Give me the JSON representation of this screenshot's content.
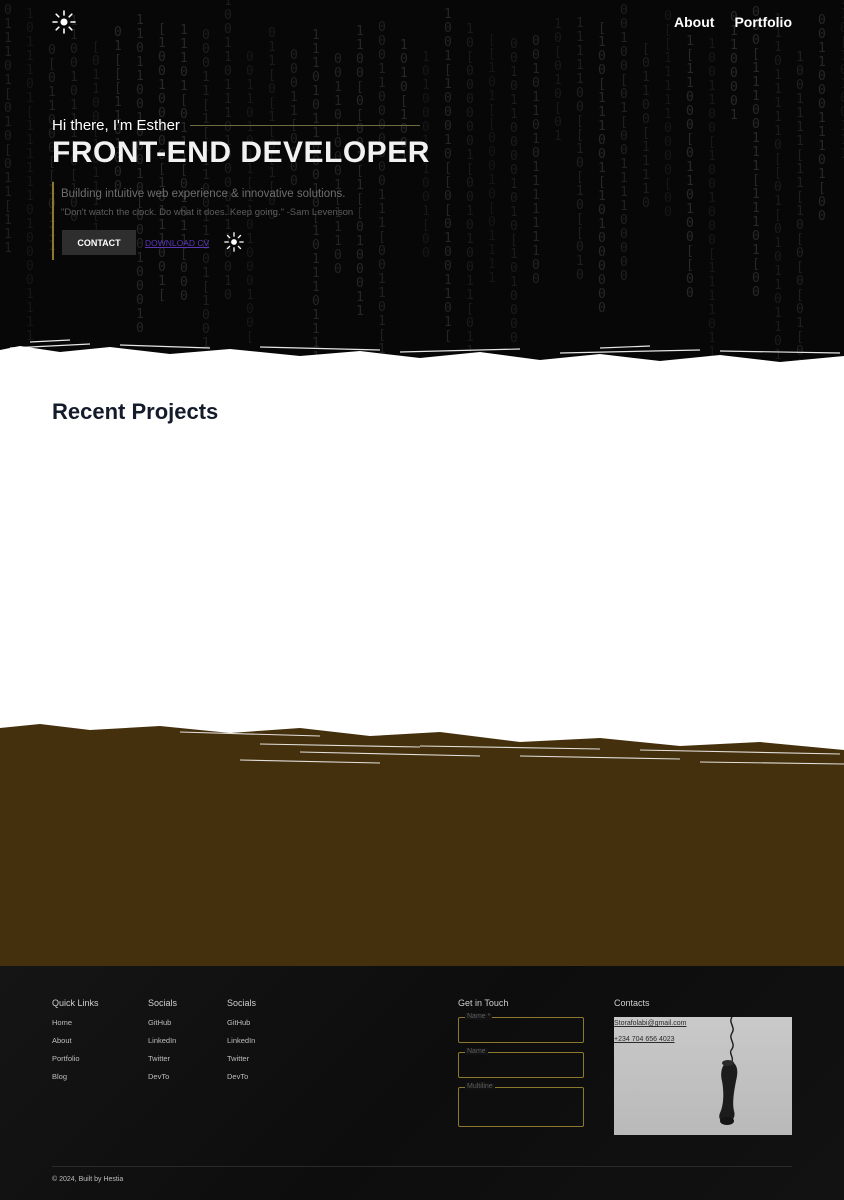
{
  "header": {
    "logo_icon": "sun-icon",
    "nav": [
      {
        "label": "About"
      },
      {
        "label": "Portfolio"
      }
    ]
  },
  "hero": {
    "greeting": "Hi there, I'm Esther",
    "title": "FRONT-END DEVELOPER",
    "tagline": "Building intuitive web experience & innovative solutions.",
    "quote": "\"Don't watch the clock. Do what it does. Keep going.\" -Sam Levenson",
    "contact_label": "CONTACT",
    "download_label": "DOWNLOAD CV",
    "accent_color": "#8b7a2d"
  },
  "projects": {
    "title": "Recent Projects"
  },
  "footer": {
    "quick_links": {
      "heading": "Quick Links",
      "items": [
        "Home",
        "About",
        "Portfolio",
        "Blog"
      ]
    },
    "socials_1": {
      "heading": "Socials",
      "items": [
        "GitHub",
        "LinkedIn",
        "Twitter",
        "DevTo"
      ]
    },
    "socials_2": {
      "heading": "Socials",
      "items": [
        "GitHub",
        "LinkedIn",
        "Twitter",
        "DevTo"
      ]
    },
    "get_in_touch": {
      "heading": "Get in Touch",
      "fields": [
        {
          "label": "Name *"
        },
        {
          "label": "Name"
        },
        {
          "label": "Multiline"
        }
      ]
    },
    "contacts": {
      "heading": "Contacts",
      "email": "Storafolabi@gmail.com",
      "phone": "+234 704 656 4023"
    },
    "copyright": "© 2024, Built by Hestia"
  },
  "colors": {
    "hero_bg": "#070707",
    "brown_band": "#45300e",
    "footer_bg": "#121212",
    "link_purple": "#5b36b5"
  }
}
